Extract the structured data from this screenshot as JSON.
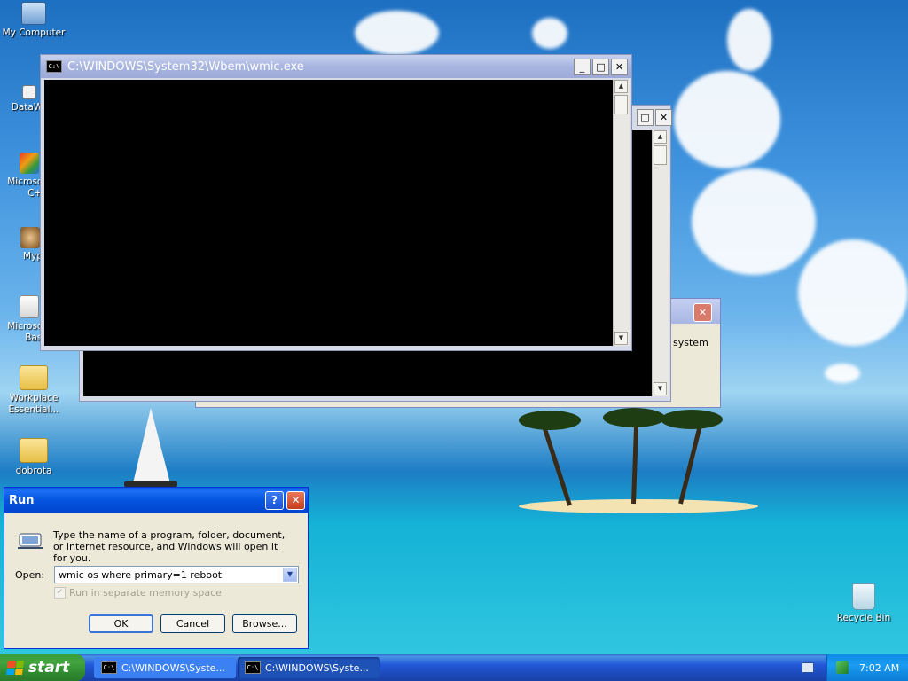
{
  "desktop": {
    "icons": [
      {
        "label": "My Computer",
        "icon": "my-computer-icon"
      },
      {
        "label": "DataWa",
        "icon": "shortcut-icon"
      },
      {
        "label": "Microsoft C++",
        "icon": "msvc-icon"
      },
      {
        "label": "Myp",
        "icon": "myp-icon"
      },
      {
        "label": "Microsoft Basic",
        "icon": "msbasic-icon"
      },
      {
        "label": "Workplace Essential...",
        "icon": "workplace-icon"
      },
      {
        "label": "dobrota",
        "icon": "dobrota-icon"
      },
      {
        "label": "Recycle Bin",
        "icon": "recycle-bin-icon"
      }
    ]
  },
  "windows": {
    "cmd_front": {
      "title": "C:\\WINDOWS\\System32\\Wbem\\wmic.exe"
    },
    "dialog_back": {
      "text": "r system"
    }
  },
  "run": {
    "title": "Run",
    "description": "Type the name of a program, folder, document, or Internet resource, and Windows will open it for you.",
    "open_label": "Open:",
    "open_value": "wmic os where primary=1 reboot",
    "checkbox_label": "Run in separate memory space",
    "ok": "OK",
    "cancel": "Cancel",
    "browse": "Browse..."
  },
  "taskbar": {
    "start": "start",
    "tasks": [
      "C:\\WINDOWS\\Syste...",
      "C:\\WINDOWS\\Syste..."
    ],
    "clock": "7:02 AM"
  },
  "colors": {
    "accent": "#0455e0",
    "console": "#000000",
    "start_green": "#3c9d3c"
  }
}
